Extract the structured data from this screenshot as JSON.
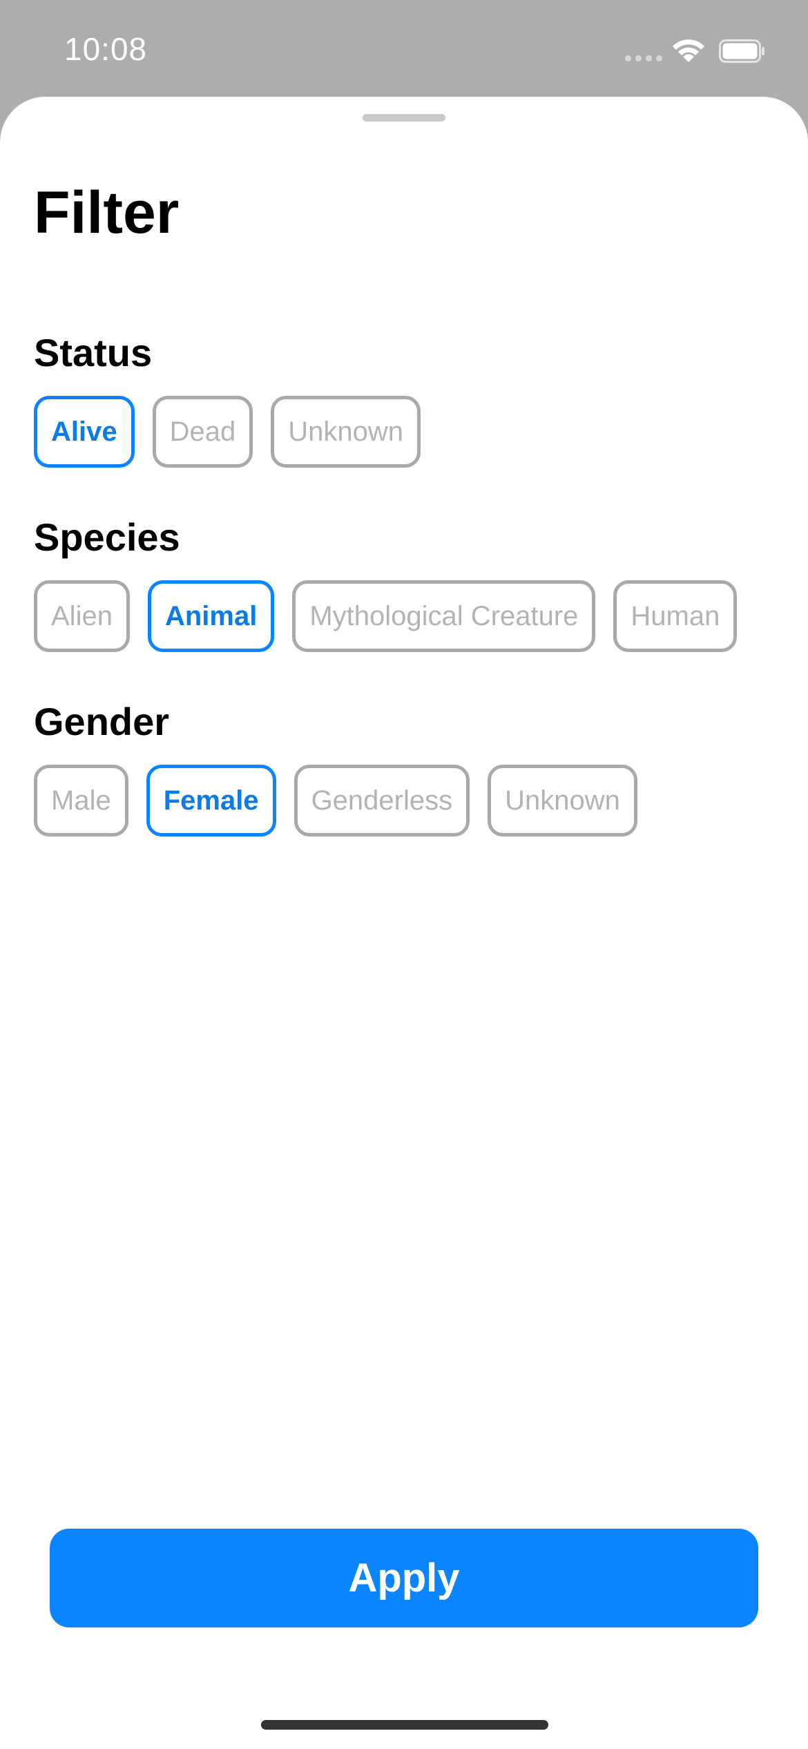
{
  "status_bar": {
    "time": "10:08"
  },
  "sheet": {
    "title": "Filter"
  },
  "sections": {
    "status": {
      "title": "Status",
      "options": [
        "Alive",
        "Dead",
        "Unknown"
      ],
      "selected": "Alive"
    },
    "species": {
      "title": "Species",
      "options": [
        "Alien",
        "Animal",
        "Mythological Creature",
        "Human"
      ],
      "selected": "Animal"
    },
    "gender": {
      "title": "Gender",
      "options": [
        "Male",
        "Female",
        "Genderless",
        "Unknown"
      ],
      "selected": "Female"
    }
  },
  "actions": {
    "apply_label": "Apply"
  },
  "colors": {
    "accent": "#0a84ff",
    "chip_border": "#a9a9a9",
    "chip_text": "#b3b3b3",
    "backdrop": "#adadad"
  }
}
